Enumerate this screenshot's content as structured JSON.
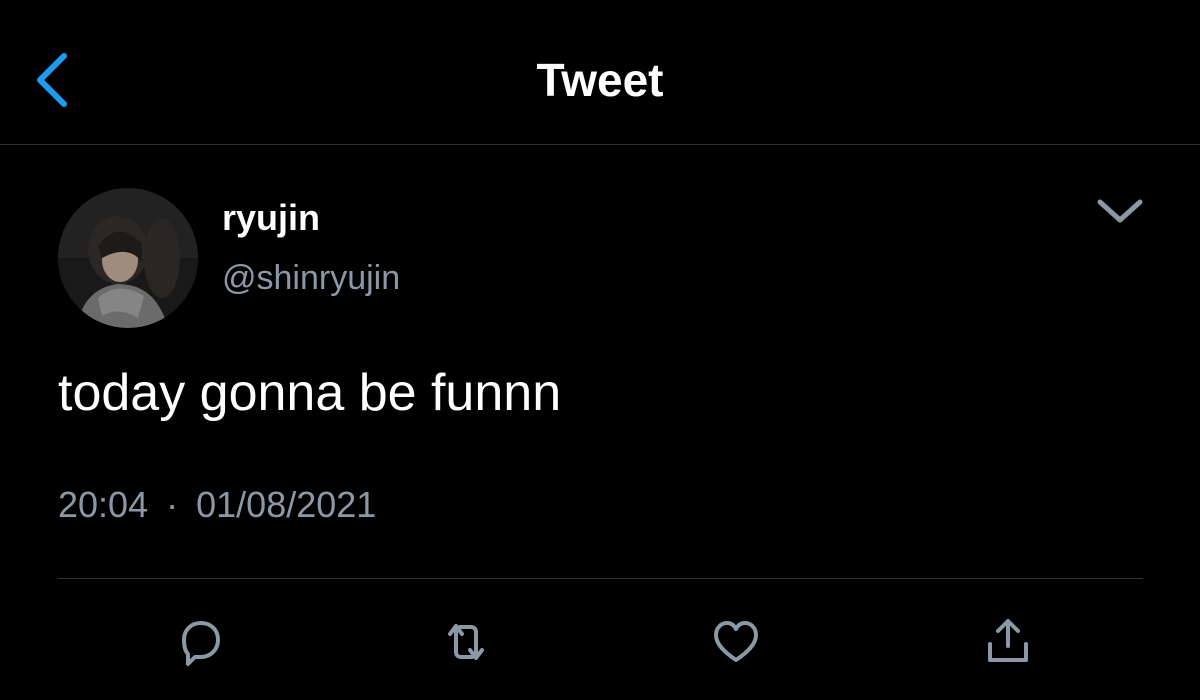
{
  "header": {
    "title": "Tweet",
    "back_icon": "chevron-left-icon",
    "accent_color": "#1d9bf0"
  },
  "tweet": {
    "author_name": "ryujin",
    "author_handle": "@shinryujin",
    "text": "today gonna be funnn",
    "time": "20:04",
    "separator": "·",
    "date": "01/08/2021",
    "more_icon": "chevron-down-icon"
  },
  "actions": [
    {
      "icon": "reply-icon"
    },
    {
      "icon": "retweet-icon"
    },
    {
      "icon": "like-icon"
    },
    {
      "icon": "share-icon"
    }
  ]
}
